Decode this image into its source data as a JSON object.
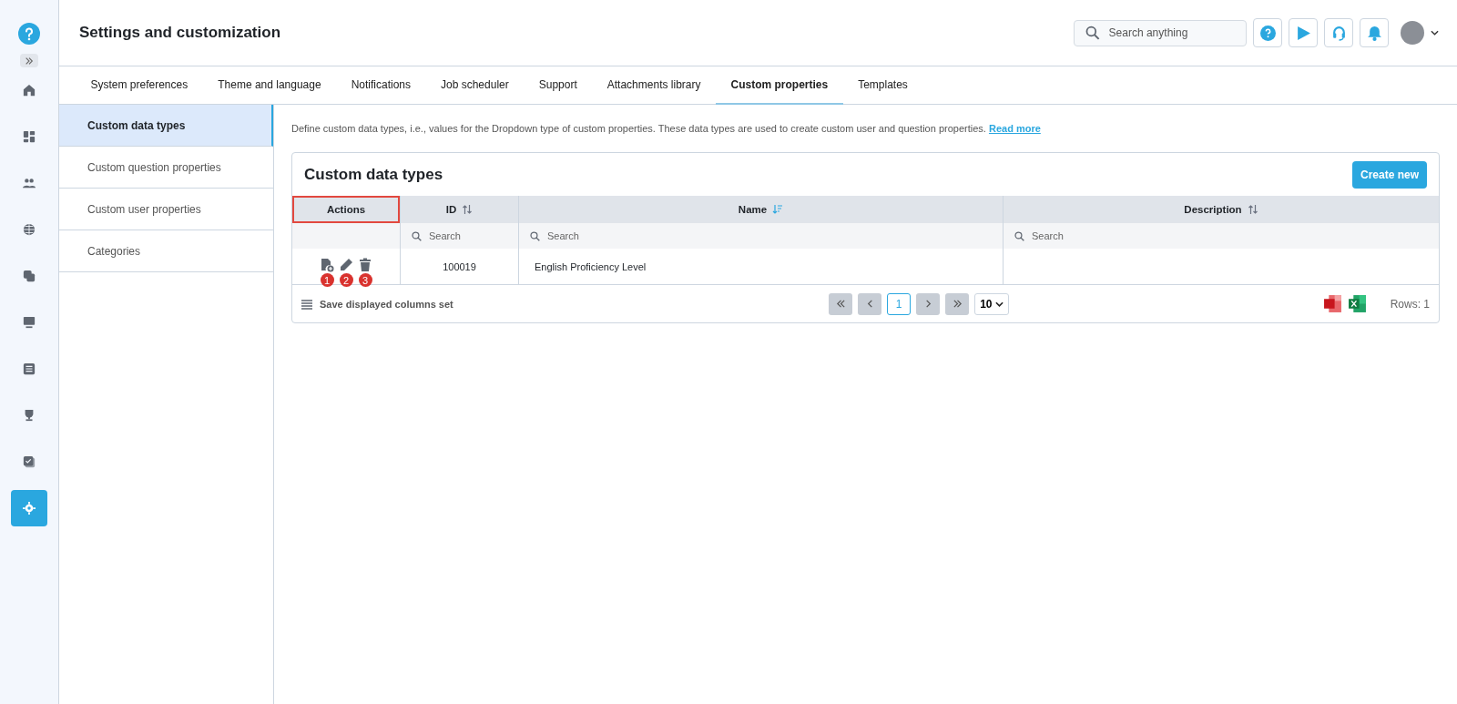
{
  "header": {
    "title": "Settings and customization",
    "search": {
      "placeholder": "Search anything"
    }
  },
  "rail": {
    "items": [
      {
        "kind": "home",
        "selected": false
      },
      {
        "kind": "dashboard",
        "selected": false
      },
      {
        "kind": "users",
        "selected": false
      },
      {
        "kind": "globe",
        "selected": false
      },
      {
        "kind": "copies",
        "selected": false
      },
      {
        "kind": "monitor",
        "selected": false
      },
      {
        "kind": "list",
        "selected": false
      },
      {
        "kind": "trophy",
        "selected": false
      },
      {
        "kind": "tasks",
        "selected": false
      },
      {
        "kind": "settings",
        "selected": true
      }
    ]
  },
  "tabs": [
    {
      "label": "System preferences",
      "selected": false
    },
    {
      "label": "Theme and language",
      "selected": false
    },
    {
      "label": "Notifications",
      "selected": false
    },
    {
      "label": "Job scheduler",
      "selected": false
    },
    {
      "label": "Support",
      "selected": false
    },
    {
      "label": "Attachments library",
      "selected": false
    },
    {
      "label": "Custom properties",
      "selected": true
    },
    {
      "label": "Templates",
      "selected": false
    }
  ],
  "subnav": [
    {
      "label": "Custom data types",
      "selected": true
    },
    {
      "label": "Custom question properties",
      "selected": false
    },
    {
      "label": "Custom user properties",
      "selected": false
    },
    {
      "label": "Categories",
      "selected": false
    }
  ],
  "description": {
    "text": "Define custom data types, i.e., values for the Dropdown type of custom properties. These data types are used to create custom user and question properties.",
    "link": "Read more"
  },
  "card": {
    "title": "Custom data types",
    "create_button": "Create new",
    "columns": [
      {
        "label": "Actions",
        "highlighted": true
      },
      {
        "label": "ID",
        "sortable": true,
        "sort_active": false,
        "highlighted": false,
        "placeholder": "Search"
      },
      {
        "label": "Name",
        "sortable": true,
        "sort_active": true,
        "highlighted": false,
        "placeholder": "Search"
      },
      {
        "label": "Description",
        "sortable": true,
        "sort_active": false,
        "highlighted": false,
        "placeholder": "Search"
      }
    ],
    "rows": [
      {
        "actions": [
          {
            "kind": "add",
            "marker": "1"
          },
          {
            "kind": "edit",
            "marker": "2"
          },
          {
            "kind": "delete",
            "marker": "3"
          }
        ],
        "id": "100019",
        "name": "English Proficiency Level"
      }
    ],
    "footer": {
      "save_columns": "Save displayed columns set",
      "current_page": "1",
      "page_size": "10",
      "rows": "Rows: 1"
    }
  }
}
